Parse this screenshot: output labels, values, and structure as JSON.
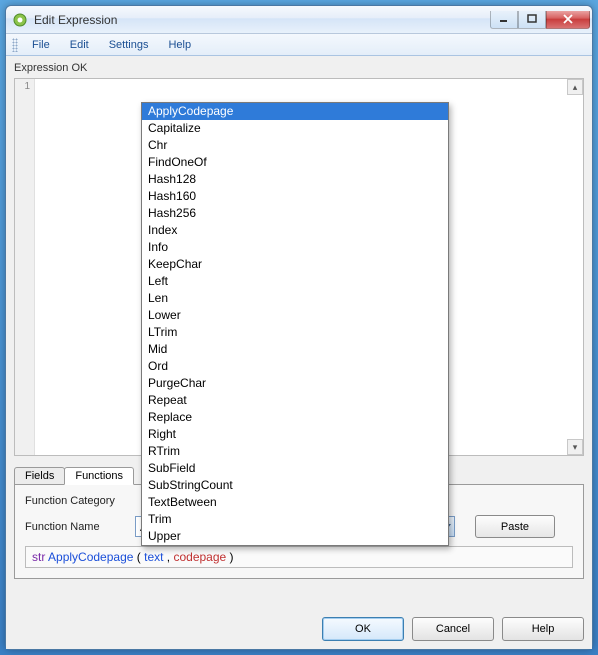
{
  "window": {
    "title": "Edit Expression"
  },
  "menubar": {
    "file": "File",
    "edit": "Edit",
    "settings": "Settings",
    "help": "Help"
  },
  "status": "Expression OK",
  "gutter": {
    "line1": "1"
  },
  "dropdown": {
    "items": [
      "ApplyCodepage",
      "Capitalize",
      "Chr",
      "FindOneOf",
      "Hash128",
      "Hash160",
      "Hash256",
      "Index",
      "Info",
      "KeepChar",
      "Left",
      "Len",
      "Lower",
      "LTrim",
      "Mid",
      "Ord",
      "PurgeChar",
      "Repeat",
      "Replace",
      "Right",
      "RTrim",
      "SubField",
      "SubStringCount",
      "TextBetween",
      "Trim",
      "Upper"
    ],
    "selected_index": 0
  },
  "tabs": {
    "fields": "Fields",
    "functions": "Functions"
  },
  "form": {
    "category_label": "Function Category",
    "name_label": "Function Name",
    "name_value": "ApplyCodepage",
    "paste": "Paste"
  },
  "signature": {
    "keyword": "str",
    "func": "ApplyCodepage",
    "open": " (",
    "arg1": "text",
    "sep": ", ",
    "arg2": "codepage",
    "close": ")"
  },
  "footer": {
    "ok": "OK",
    "cancel": "Cancel",
    "help": "Help"
  }
}
